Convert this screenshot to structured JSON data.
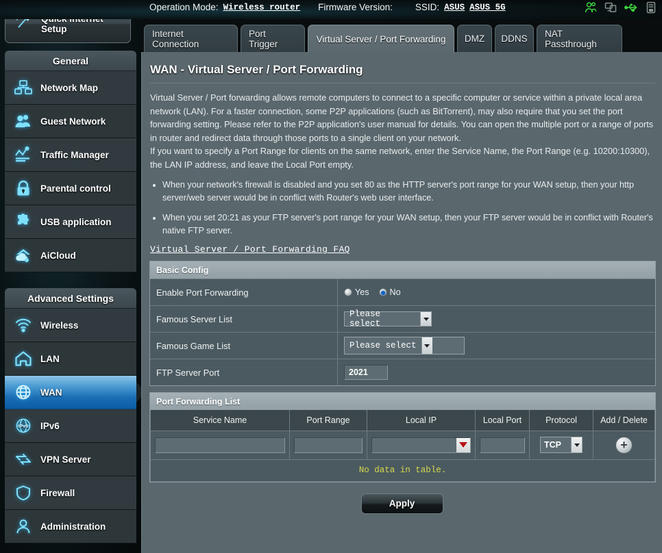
{
  "header": {
    "operation_mode_label": "Operation Mode:",
    "operation_mode_value": "Wireless router",
    "firmware_label": "Firmware Version:",
    "firmware_value": "",
    "ssid_label": "SSID:",
    "ssid_value_1": "ASUS",
    "ssid_value_2": "ASUS_5G",
    "icons": [
      "clients-icon",
      "monitors-icon",
      "usb-icon",
      "printer-icon"
    ],
    "accent_green": "#39d13f"
  },
  "quick_setup": {
    "label": "Quick Internet Setup",
    "icon": "magic-wand-icon"
  },
  "sidebar": {
    "general_title": "General",
    "general_items": [
      {
        "label": "Network Map",
        "icon": "network-map-icon"
      },
      {
        "label": "Guest Network",
        "icon": "guest-network-icon"
      },
      {
        "label": "Traffic Manager",
        "icon": "traffic-manager-icon"
      },
      {
        "label": "Parental control",
        "icon": "lock-icon"
      },
      {
        "label": "USB application",
        "icon": "puzzle-icon"
      },
      {
        "label": "AiCloud",
        "icon": "cloud-icon"
      }
    ],
    "advanced_title": "Advanced Settings",
    "advanced_items": [
      {
        "label": "Wireless",
        "icon": "wifi-icon",
        "active": false
      },
      {
        "label": "LAN",
        "icon": "home-icon",
        "active": false
      },
      {
        "label": "WAN",
        "icon": "globe-icon",
        "active": true
      },
      {
        "label": "IPv6",
        "icon": "ipv6-icon",
        "active": false
      },
      {
        "label": "VPN Server",
        "icon": "vpn-icon",
        "active": false
      },
      {
        "label": "Firewall",
        "icon": "shield-icon",
        "active": false
      },
      {
        "label": "Administration",
        "icon": "person-icon",
        "active": false
      }
    ]
  },
  "tabs": [
    {
      "label": "Internet Connection",
      "selected": false
    },
    {
      "label": "Port Trigger",
      "selected": false
    },
    {
      "label": "Virtual Server / Port Forwarding",
      "selected": true
    },
    {
      "label": "DMZ",
      "selected": false
    },
    {
      "label": "DDNS",
      "selected": false
    },
    {
      "label": "NAT Passthrough",
      "selected": false
    }
  ],
  "page": {
    "title": "WAN - Virtual Server / Port Forwarding",
    "description_p1": "Virtual Server / Port forwarding allows remote computers to connect to a specific computer or service within a private local area network (LAN). For a faster connection, some P2P applications (such as BitTorrent), may also require that you set the port forwarding setting. Please refer to the P2P application's user manual for details. You can open the multiple port or a range of ports in router and redirect data through those ports to a single client on your network.",
    "description_p2": "If you want to specify a Port Range for clients on the same network, enter the Service Name, the Port Range (e.g. 10200:10300), the LAN IP address, and leave the Local Port empty.",
    "bullets": [
      "When your network's firewall is disabled and you set 80 as the HTTP server's port range for your WAN setup, then your http server/web server would be in conflict with Router's web user interface.",
      "When you set 20:21 as your FTP server's port range for your WAN setup, then your FTP server would be in conflict with Router's native FTP server."
    ],
    "faq_link": "Virtual Server / Port Forwarding FAQ"
  },
  "basic_config": {
    "title": "Basic Config",
    "enable_label": "Enable Port Forwarding",
    "enable_yes": "Yes",
    "enable_no": "No",
    "enable_selected": "No",
    "famous_server_label": "Famous Server List",
    "famous_server_value": "Please select",
    "famous_game_label": "Famous Game List",
    "famous_game_value": "Please select",
    "ftp_port_label": "FTP Server Port",
    "ftp_port_value": "2021"
  },
  "port_forwarding_list": {
    "title": "Port Forwarding List",
    "columns": [
      "Service Name",
      "Port Range",
      "Local IP",
      "Local Port",
      "Protocol",
      "Add / Delete"
    ],
    "input_row": {
      "service_name": "",
      "port_range": "",
      "local_ip": "",
      "local_port": "",
      "protocol": "TCP",
      "add_button": "+"
    },
    "empty_message": "No data in table.",
    "empty_message_color": "#d8d84a"
  },
  "apply_button": "Apply"
}
